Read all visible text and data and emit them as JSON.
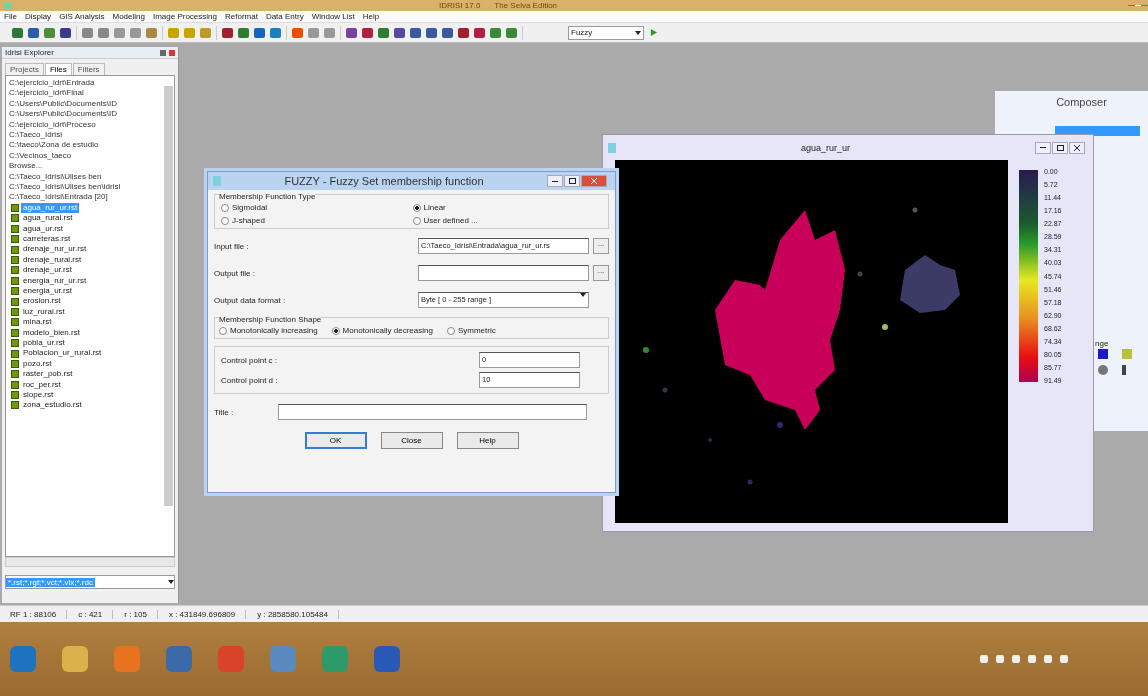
{
  "app": {
    "title": "IDRISI 17.0",
    "edition": "The Selva Edition"
  },
  "menu": [
    "File",
    "Display",
    "GIS Analysis",
    "Modeling",
    "Image Processing",
    "Reformat",
    "Data Entry",
    "Window List",
    "Help"
  ],
  "toolbar": {
    "module": "Fuzzy"
  },
  "explorer": {
    "title": "Idrisi Explorer",
    "tabs": [
      {
        "label": "Projects",
        "selected": false
      },
      {
        "label": "Files",
        "selected": true
      },
      {
        "label": "Filters",
        "selected": false
      }
    ],
    "folders": [
      "C:\\ejercicio_idrt\\Entrada",
      "C:\\ejercicio_idrt\\Final",
      "C:\\Users\\Public\\Documents\\ID",
      "C:\\Users\\Public\\Documents\\ID",
      "C:\\ejercicio_idrt\\Proceso",
      "C:\\Taeco_Idrisi",
      "C:\\taeco\\Zona de estudio",
      "C:\\Vecinos_taeco",
      "Browse...",
      "C:\\Taeco_Idrisi\\Ulises ben",
      "C:\\Taeco_Idrisi\\Ulises ben\\idrisi",
      "C:\\Taeco_Idrisi\\Entrada [20]"
    ],
    "files": [
      {
        "name": "agua_rur_ur.rst",
        "selected": true
      },
      {
        "name": "agua_rural.rst",
        "selected": false
      },
      {
        "name": "agua_ur.rst",
        "selected": false
      },
      {
        "name": "carreteras.rst",
        "selected": false
      },
      {
        "name": "drenaje_rur_ur.rst",
        "selected": false
      },
      {
        "name": "drenaje_rural.rst",
        "selected": false
      },
      {
        "name": "drenaje_ur.rst",
        "selected": false
      },
      {
        "name": "energia_rur_ur.rst",
        "selected": false
      },
      {
        "name": "energia_ur.rst",
        "selected": false
      },
      {
        "name": "erosion.rst",
        "selected": false
      },
      {
        "name": "luz_rural.rst",
        "selected": false
      },
      {
        "name": "mina.rst",
        "selected": false
      },
      {
        "name": "modelo_bien.rst",
        "selected": false
      },
      {
        "name": "pobla_ur.rst",
        "selected": false
      },
      {
        "name": "Poblacion_ur_rural.rst",
        "selected": false
      },
      {
        "name": "pozo.rst",
        "selected": false
      },
      {
        "name": "raster_pob.rst",
        "selected": false
      },
      {
        "name": "roc_per.rst",
        "selected": false
      },
      {
        "name": "slope.rst",
        "selected": false
      },
      {
        "name": "zona_estudio.rst",
        "selected": false
      }
    ],
    "filter": "*.rst;*.rgf;*.vct;*.vlx;*.rdc"
  },
  "dialog": {
    "title": "FUZZY - Fuzzy Set membership function",
    "type_group": "Membership Function Type",
    "types": [
      {
        "label": "Sigmoidal",
        "selected": false
      },
      {
        "label": "Linear",
        "selected": true
      },
      {
        "label": "J-shaped",
        "selected": false
      },
      {
        "label": "User defined ...",
        "selected": false
      }
    ],
    "browse_label": "...",
    "input_label": "Input file :",
    "input_value": "C:\\Taeco_Idrisi\\Entrada\\agua_rur_ur.rs",
    "output_label": "Output file :",
    "format_label": "Output data format :",
    "format_value": "Byte  [ 0 - 255 range ]",
    "shape_group": "Membership Function Shape",
    "shapes": [
      {
        "label": "Monotonically increasing",
        "selected": false
      },
      {
        "label": "Monotonically decreasing",
        "selected": true
      },
      {
        "label": "Symmetric",
        "selected": false
      }
    ],
    "c_label": "Control point c :",
    "c_value": "0",
    "d_label": "Control point d :",
    "d_value": "10",
    "title_label": "Title :",
    "buttons": [
      "OK",
      "Close",
      "Help"
    ]
  },
  "map_window": {
    "title": "agua_rur_ur",
    "legend": [
      "0.00",
      "5.72",
      "11.44",
      "17.16",
      "22.87",
      "28.59",
      "34.31",
      "40.03",
      "45.74",
      "51.46",
      "57.18",
      "62.90",
      "68.62",
      "74.34",
      "80.05",
      "85.77",
      "91.49"
    ]
  },
  "composer": {
    "title": "Composer",
    "cut_label": "nge"
  },
  "status_bar": [
    "RF 1 : 88106",
    "c : 421",
    "r : 105",
    "x : 431849.696809",
    "y : 2858580.105484"
  ]
}
